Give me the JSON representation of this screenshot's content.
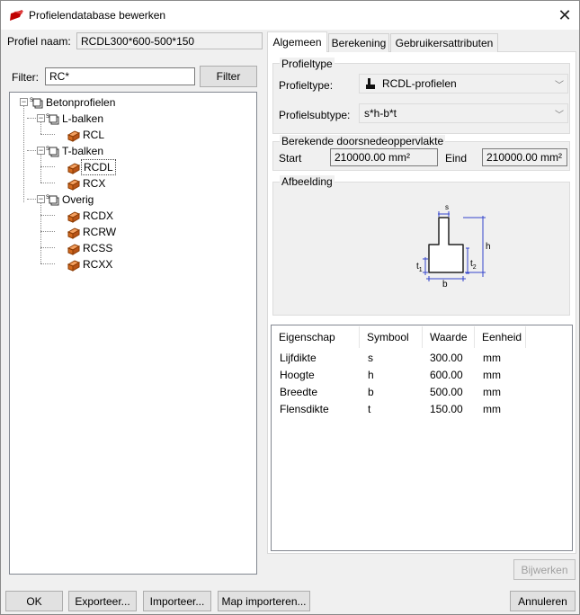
{
  "window": {
    "title": "Profielendatabase bewerken"
  },
  "profile": {
    "name_label": "Profiel naam:",
    "name_value": "RCDL300*600-500*150"
  },
  "filter": {
    "label": "Filter:",
    "value": "RC*",
    "button": "Filter"
  },
  "tree": {
    "root": "Betonprofielen",
    "groups": [
      {
        "label": "L-balken",
        "items": [
          "RCL"
        ]
      },
      {
        "label": "T-balken",
        "items": [
          "RCDL",
          "RCX"
        ]
      },
      {
        "label": "Overig",
        "items": [
          "RCDX",
          "RCRW",
          "RCSS",
          "RCXX"
        ]
      }
    ],
    "selected": "RCDL"
  },
  "tabs": [
    "Algemeen",
    "Berekening",
    "Gebruikersattributen"
  ],
  "general": {
    "profiletype_group": "Profieltype",
    "profiletype_label": "Profieltype:",
    "profiletype_value": "RCDL-profielen",
    "subtype_label": "Profielsubtype:",
    "subtype_value": "s*h-b*t",
    "area_group": "Berekende doorsnedeoppervlakte",
    "start_label": "Start",
    "start_value": "210000.00 mm²",
    "end_label": "Eind",
    "end_value": "210000.00 mm²",
    "image_group": "Afbeelding",
    "dims": {
      "s": "s",
      "h": "h",
      "b": "b",
      "t1": "t",
      "t1_sub": "1",
      "t2": "t",
      "t2_sub": "2"
    }
  },
  "properties": {
    "headers": [
      "Eigenschap",
      "Symbool",
      "Waarde",
      "Eenheid"
    ],
    "rows": [
      [
        "Lijfdikte",
        "s",
        "300.00",
        "mm"
      ],
      [
        "Hoogte",
        "h",
        "600.00",
        "mm"
      ],
      [
        "Breedte",
        "b",
        "500.00",
        "mm"
      ],
      [
        "Flensdikte",
        "t",
        "150.00",
        "mm"
      ]
    ]
  },
  "buttons": {
    "apply": "Bijwerken",
    "ok": "OK",
    "export": "Exporteer...",
    "import": "Importeer...",
    "import_map": "Map importeren...",
    "cancel": "Annuleren"
  },
  "colors": {
    "accent": "#c00000",
    "dim_line": "#3344cc",
    "profile_icon": "#d2691e"
  }
}
